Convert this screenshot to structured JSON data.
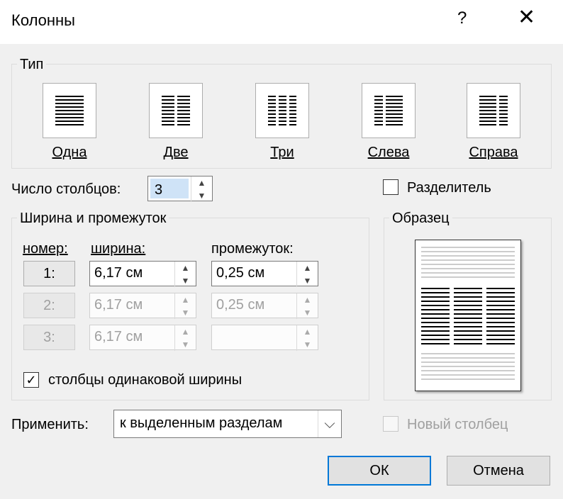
{
  "window": {
    "title": "Колонны",
    "help_glyph": "?",
    "close_glyph": "✕"
  },
  "type_group": {
    "legend": "Тип",
    "options": [
      {
        "label": "Одна",
        "icon": "one-column-icon"
      },
      {
        "label": "Две",
        "icon": "two-columns-icon"
      },
      {
        "label": "Три",
        "icon": "three-columns-icon"
      },
      {
        "label": "Слева",
        "icon": "left-column-icon"
      },
      {
        "label": "Справа",
        "icon": "right-column-icon"
      }
    ]
  },
  "columns_count": {
    "label": "Число столбцов:",
    "value": "3"
  },
  "separator": {
    "label": "Разделитель",
    "checked": false
  },
  "width_group": {
    "legend": "Ширина и промежуток",
    "headers": {
      "number": "номер:",
      "width": "ширина:",
      "spacing": "промежуток:"
    },
    "rows": [
      {
        "number": "1:",
        "width": "6,17 см",
        "spacing": "0,25 см",
        "enabled": true
      },
      {
        "number": "2:",
        "width": "6,17 см",
        "spacing": "0,25 см",
        "enabled": false
      },
      {
        "number": "3:",
        "width": "6,17 см",
        "spacing": "",
        "enabled": false
      }
    ],
    "equal_width": {
      "label": "столбцы одинаковой ширины",
      "checked": true
    }
  },
  "preview_group": {
    "legend": "Образец"
  },
  "apply": {
    "label": "Применить:",
    "value": "к выделенным разделам"
  },
  "new_column": {
    "label": "Новый столбец",
    "checked": false,
    "enabled": false
  },
  "buttons": {
    "ok": "ОК",
    "cancel": "Отмена"
  },
  "glyphs": {
    "up": "▲",
    "down": "▼",
    "check": "✓",
    "dropdown": "⌵"
  },
  "colors": {
    "accent": "#0078d7",
    "dialog_bg": "#f0f0f0"
  }
}
